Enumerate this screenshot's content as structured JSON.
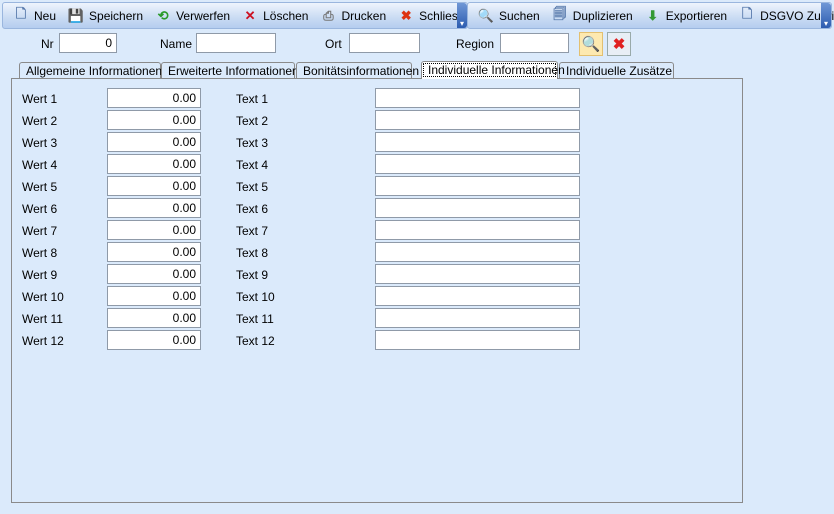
{
  "toolbar1": [
    {
      "label": "Neu",
      "icon": "new-document-icon",
      "glyph": "🗋",
      "color": "#5577aa"
    },
    {
      "label": "Speichern",
      "icon": "save-icon",
      "glyph": "💾",
      "color": "#334499"
    },
    {
      "label": "Verwerfen",
      "icon": "discard-icon",
      "glyph": "⟲",
      "color": "#2a9a2a"
    },
    {
      "label": "Löschen",
      "icon": "delete-icon",
      "glyph": "✕",
      "color": "#cc1122"
    },
    {
      "label": "Drucken",
      "icon": "print-icon",
      "glyph": "⎙",
      "color": "#777777"
    },
    {
      "label": "Schliessen",
      "icon": "close-icon",
      "glyph": "✖",
      "color": "#dd3311"
    }
  ],
  "toolbar2": [
    {
      "label": "Suchen",
      "icon": "search-icon",
      "glyph": "🔍",
      "color": "#336699"
    },
    {
      "label": "Duplizieren",
      "icon": "duplicate-icon",
      "glyph": "🗐",
      "color": "#5577aa"
    },
    {
      "label": "Exportieren",
      "icon": "export-icon",
      "glyph": "⬇",
      "color": "#339933"
    },
    {
      "label": "DSGVO Zugriff",
      "icon": "document-icon",
      "glyph": "🗋",
      "color": "#5577aa"
    }
  ],
  "filter": {
    "nr_label": "Nr",
    "nr_value": "0",
    "name_label": "Name",
    "name_value": "",
    "ort_label": "Ort",
    "ort_value": "",
    "region_label": "Region",
    "region_value": ""
  },
  "tabs": [
    "Allgemeine Informationen",
    "Erweiterte Informationen",
    "Bonitätsinformationen",
    "Individuelle Informationen",
    "Individuelle Zusätze"
  ],
  "active_tab": 3,
  "rows": [
    {
      "wert_label": "Wert 1",
      "wert": "0.00",
      "text_label": "Text 1",
      "text": ""
    },
    {
      "wert_label": "Wert 2",
      "wert": "0.00",
      "text_label": "Text 2",
      "text": ""
    },
    {
      "wert_label": "Wert 3",
      "wert": "0.00",
      "text_label": "Text 3",
      "text": ""
    },
    {
      "wert_label": "Wert 4",
      "wert": "0.00",
      "text_label": "Text 4",
      "text": ""
    },
    {
      "wert_label": "Wert 5",
      "wert": "0.00",
      "text_label": "Text 5",
      "text": ""
    },
    {
      "wert_label": "Wert 6",
      "wert": "0.00",
      "text_label": "Text 6",
      "text": ""
    },
    {
      "wert_label": "Wert 7",
      "wert": "0.00",
      "text_label": "Text 7",
      "text": ""
    },
    {
      "wert_label": "Wert 8",
      "wert": "0.00",
      "text_label": "Text 8",
      "text": ""
    },
    {
      "wert_label": "Wert 9",
      "wert": "0.00",
      "text_label": "Text 9",
      "text": ""
    },
    {
      "wert_label": "Wert 10",
      "wert": "0.00",
      "text_label": "Text 10",
      "text": ""
    },
    {
      "wert_label": "Wert 11",
      "wert": "0.00",
      "text_label": "Text 11",
      "text": ""
    },
    {
      "wert_label": "Wert 12",
      "wert": "0.00",
      "text_label": "Text 12",
      "text": ""
    }
  ]
}
